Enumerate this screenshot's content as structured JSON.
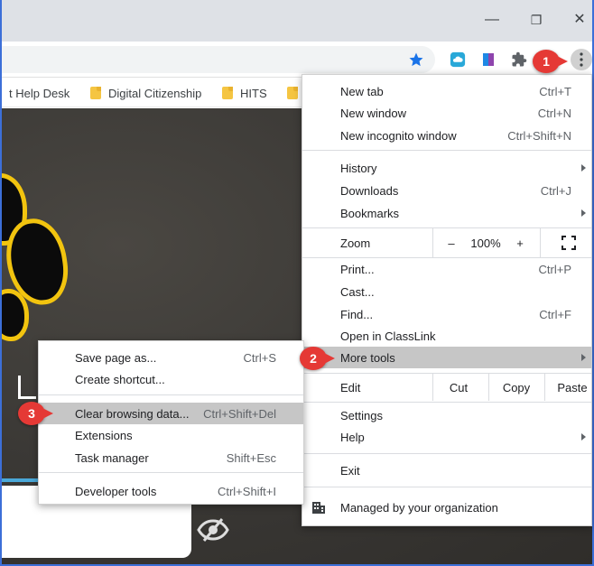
{
  "window": {
    "minimize": "—",
    "restore": "❐",
    "close": "✕"
  },
  "bookmarks": [
    {
      "label": "t Help Desk"
    },
    {
      "label": "Digital Citizenship"
    },
    {
      "label": "HITS"
    }
  ],
  "main_menu": {
    "new_tab": {
      "label": "New tab",
      "shortcut": "Ctrl+T"
    },
    "new_window": {
      "label": "New window",
      "shortcut": "Ctrl+N"
    },
    "new_incognito": {
      "label": "New incognito window",
      "shortcut": "Ctrl+Shift+N"
    },
    "history": {
      "label": "History"
    },
    "downloads": {
      "label": "Downloads",
      "shortcut": "Ctrl+J"
    },
    "bookmarks": {
      "label": "Bookmarks"
    },
    "zoom": {
      "label": "Zoom",
      "minus": "–",
      "value": "100%",
      "plus": "+"
    },
    "print": {
      "label": "Print...",
      "shortcut": "Ctrl+P"
    },
    "cast": {
      "label": "Cast..."
    },
    "find": {
      "label": "Find...",
      "shortcut": "Ctrl+F"
    },
    "open_classlink": {
      "label": "Open in ClassLink"
    },
    "more_tools": {
      "label": "More tools"
    },
    "edit": {
      "label": "Edit",
      "cut": "Cut",
      "copy": "Copy",
      "paste": "Paste"
    },
    "settings": {
      "label": "Settings"
    },
    "help": {
      "label": "Help"
    },
    "exit": {
      "label": "Exit"
    },
    "managed": {
      "label": "Managed by your organization"
    }
  },
  "sub_menu": {
    "save_page": {
      "label": "Save page as...",
      "shortcut": "Ctrl+S"
    },
    "create_shortcut": {
      "label": "Create shortcut..."
    },
    "clear_data": {
      "label": "Clear browsing data...",
      "shortcut": "Ctrl+Shift+Del"
    },
    "extensions": {
      "label": "Extensions"
    },
    "task_manager": {
      "label": "Task manager",
      "shortcut": "Shift+Esc"
    },
    "dev_tools": {
      "label": "Developer tools",
      "shortcut": "Ctrl+Shift+I"
    }
  },
  "badges": {
    "one": "1",
    "two": "2",
    "three": "3"
  },
  "colors": {
    "badge": "#e53935",
    "highlight": "#c6c6c6",
    "star": "#1a73e8",
    "paw_outline": "#f2c40f"
  }
}
